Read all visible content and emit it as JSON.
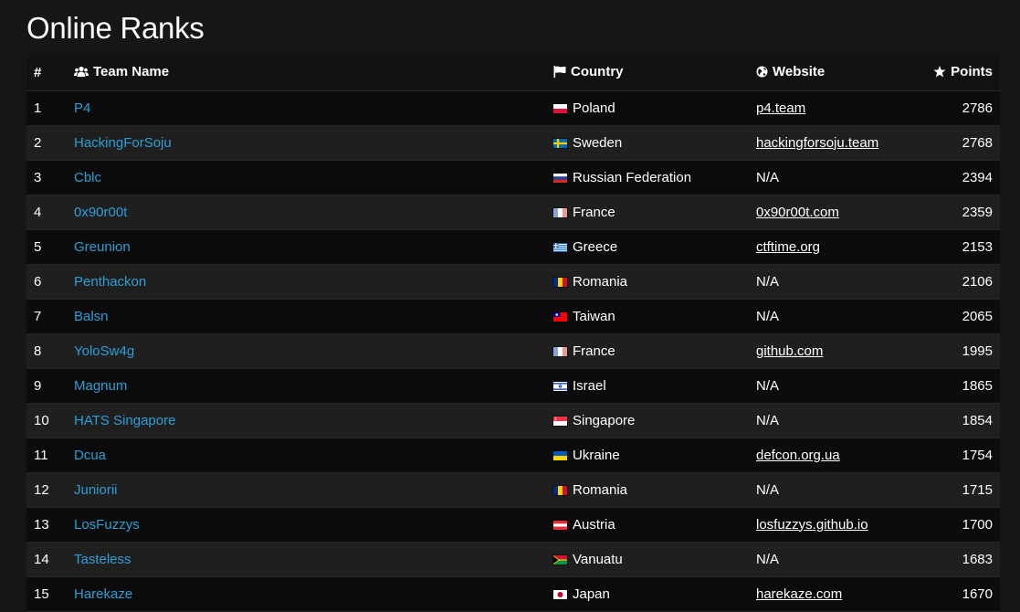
{
  "page": {
    "title": "Online Ranks"
  },
  "table": {
    "columns": {
      "rank": "#",
      "team": "Team Name",
      "country": "Country",
      "website": "Website",
      "points": "Points"
    },
    "rows": [
      {
        "rank": "1",
        "team": "P4",
        "country": "Poland",
        "flag": "poland",
        "website": "p4.team",
        "points": "2786"
      },
      {
        "rank": "2",
        "team": "HackingForSoju",
        "country": "Sweden",
        "flag": "sweden",
        "website": "hackingforsoju.team",
        "points": "2768"
      },
      {
        "rank": "3",
        "team": "Cblc",
        "country": "Russian Federation",
        "flag": "russia",
        "website": "N/A",
        "points": "2394"
      },
      {
        "rank": "4",
        "team": "0x90r00t",
        "country": "France",
        "flag": "france",
        "website": "0x90r00t.com",
        "points": "2359"
      },
      {
        "rank": "5",
        "team": "Greunion",
        "country": "Greece",
        "flag": "greece",
        "website": "ctftime.org",
        "points": "2153"
      },
      {
        "rank": "6",
        "team": "Penthackon",
        "country": "Romania",
        "flag": "romania",
        "website": "N/A",
        "points": "2106"
      },
      {
        "rank": "7",
        "team": "Balsn",
        "country": "Taiwan",
        "flag": "taiwan",
        "website": "N/A",
        "points": "2065"
      },
      {
        "rank": "8",
        "team": "YoloSw4g",
        "country": "France",
        "flag": "france",
        "website": "github.com",
        "points": "1995"
      },
      {
        "rank": "9",
        "team": "Magnum",
        "country": "Israel",
        "flag": "israel",
        "website": "N/A",
        "points": "1865"
      },
      {
        "rank": "10",
        "team": "HATS Singapore",
        "country": "Singapore",
        "flag": "singapore",
        "website": "N/A",
        "points": "1854"
      },
      {
        "rank": "11",
        "team": "Dcua",
        "country": "Ukraine",
        "flag": "ukraine",
        "website": "defcon.org.ua",
        "points": "1754"
      },
      {
        "rank": "12",
        "team": "Juniorii",
        "country": "Romania",
        "flag": "romania",
        "website": "N/A",
        "points": "1715"
      },
      {
        "rank": "13",
        "team": "LosFuzzys",
        "country": "Austria",
        "flag": "austria",
        "website": "losfuzzys.github.io",
        "points": "1700"
      },
      {
        "rank": "14",
        "team": "Tasteless",
        "country": "Vanuatu",
        "flag": "vanuatu",
        "website": "N/A",
        "points": "1683"
      },
      {
        "rank": "15",
        "team": "Harekaze",
        "country": "Japan",
        "flag": "japan",
        "website": "harekaze.com",
        "points": "1670"
      }
    ]
  },
  "colors": {
    "background": "#161616",
    "row_dark": "#0b0b0b",
    "row_light": "#1f1f1f",
    "team_link": "#2a9fd6",
    "text": "#ffffff"
  },
  "icons": {
    "team": "users-icon",
    "country": "flag-icon",
    "website": "globe-icon",
    "points": "star-icon"
  }
}
